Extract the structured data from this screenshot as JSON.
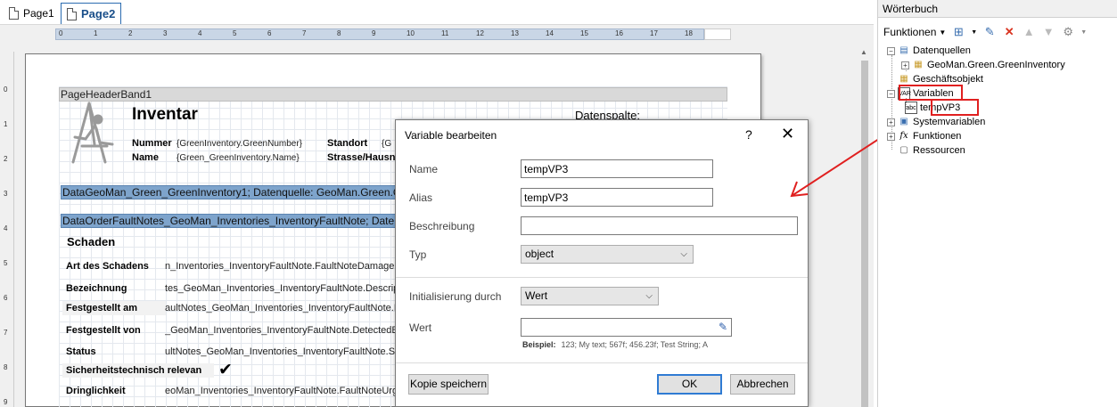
{
  "tabs": [
    {
      "label": "Page1",
      "active": false
    },
    {
      "label": "Page2",
      "active": true
    }
  ],
  "ruler": {
    "h_numbers": [
      "0",
      "1",
      "2",
      "3",
      "4",
      "5",
      "6",
      "7",
      "8",
      "9",
      "10",
      "11",
      "12",
      "13",
      "14",
      "15",
      "16",
      "17",
      "18"
    ],
    "v_numbers": [
      "0",
      "1",
      "2",
      "3",
      "4",
      "5",
      "6",
      "7",
      "8",
      "9"
    ]
  },
  "report": {
    "page_header_band": "PageHeaderBand1",
    "title": "Inventar",
    "datenspalte": "Datenspalte:",
    "header_fields": [
      {
        "label": "Nummer",
        "value": "{GreenInventory.GreenNumber}"
      },
      {
        "label": "Name",
        "value": "{Green_GreenInventory.Name}"
      }
    ],
    "header_fields_right": [
      {
        "label": "Standort",
        "value": "{G"
      },
      {
        "label": "Strasse/Hausn",
        "value": ""
      }
    ],
    "band_data1": "DataGeoMan_Green_GreenInventory1;  Datenquelle:  GeoMan.Green.GreenInventory",
    "band_data2": "DataOrderFaultNotes_GeoMan_Inventories_InventoryFaultNote;  Datenquelle",
    "section_title": "Schaden",
    "rows": [
      {
        "label": "Art des Schadens",
        "value": "n_Inventories_InventoryFaultNote.FaultNoteDamageFr",
        "grey": false
      },
      {
        "label": "Bezeichnung",
        "value": "tes_GeoMan_Inventories_InventoryFaultNote.Descrip",
        "grey": false
      },
      {
        "label": "Festgestellt am",
        "value": "aultNotes_GeoMan_Inventories_InventoryFaultNote.D",
        "grey": true
      },
      {
        "label": "Festgestellt von",
        "value": "_GeoMan_Inventories_InventoryFaultNote.DetectedBy",
        "grey": false
      },
      {
        "label": "Status",
        "value": "ultNotes_GeoMan_Inventories_InventoryFaultNote.S",
        "grey": false
      },
      {
        "label": "Sicherheitstechnisch relevan",
        "value": "",
        "grey": true
      },
      {
        "label": "Dringlichkeit",
        "value": "eoMan_Inventories_InventoryFaultNote.FaultNoteUrg",
        "grey": false
      }
    ],
    "checkmark": "✔"
  },
  "dialog": {
    "title": "Variable bearbeiten",
    "help": "?",
    "close": "✕",
    "fields": {
      "name_label": "Name",
      "name_value": "tempVP3",
      "alias_label": "Alias",
      "alias_value": "tempVP3",
      "beschreibung_label": "Beschreibung",
      "beschreibung_value": "",
      "typ_label": "Typ",
      "typ_value": "object",
      "init_label": "Initialisierung durch",
      "init_value": "Wert",
      "wert_label": "Wert",
      "wert_value": "",
      "beispiel_label": "Beispiel:",
      "beispiel_text": "123; My text; 567f; 456.23f; Test String; A"
    },
    "buttons": {
      "copy": "Kopie speichern",
      "ok": "OK",
      "cancel": "Abbrechen"
    }
  },
  "dictionary": {
    "title": "Wörterbuch",
    "toolbar": {
      "functions": "Funktionen"
    },
    "tree": [
      {
        "label": "Datenquellen",
        "level": 0,
        "expander": "−"
      },
      {
        "label": "GeoMan.Green.GreenInventory",
        "level": 1,
        "expander": "+"
      },
      {
        "label": "Geschäftsobjekt",
        "level": 0,
        "expander": ""
      },
      {
        "label": "Variablen",
        "level": 0,
        "expander": "−"
      },
      {
        "label": "tempVP3",
        "level": 1,
        "expander": ""
      },
      {
        "label": "Systemvariablen",
        "level": 0,
        "expander": "+"
      },
      {
        "label": "Funktionen",
        "level": 0,
        "expander": "+"
      },
      {
        "label": "Ressourcen",
        "level": 0,
        "expander": ""
      }
    ]
  },
  "colors": {
    "accent": "#2f7bd3",
    "band_blue": "#7ea4cc",
    "annotation_red": "#e02020"
  }
}
